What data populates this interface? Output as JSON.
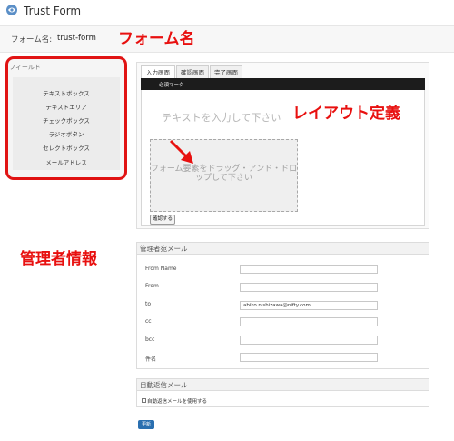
{
  "header": {
    "title": "Trust Form",
    "logo_icon": "trust-logo-icon"
  },
  "form_name": {
    "label": "フォーム名:",
    "value": "trust-form"
  },
  "annotations": {
    "form_name": "フォーム名",
    "layout": "レイアウト定義",
    "admin": "管理者情報",
    "color": "#e8100f"
  },
  "fields_panel": {
    "title": "フィールド",
    "items": [
      "テキストボックス",
      "テキストエリア",
      "チェックボックス",
      "ラジオボタン",
      "セレクトボックス",
      "メールアドレス"
    ]
  },
  "tabs": [
    {
      "label": "入力画面",
      "active": true
    },
    {
      "label": "確認画面",
      "active": false
    },
    {
      "label": "完了画面",
      "active": false
    }
  ],
  "input_screen": {
    "required_label": "必須マーク",
    "placeholder": "テキストを入力して下さい",
    "drop_hint": "フォーム要素をドラッグ・アンド・ドロップして下さい",
    "confirm_button": "確認する"
  },
  "admin_mail": {
    "title": "管理者宛メール",
    "rows": [
      {
        "label": "From Name",
        "value": ""
      },
      {
        "label": "From",
        "value": ""
      },
      {
        "label": "to",
        "value": "abiko.nishizawa@nifty.com"
      },
      {
        "label": "cc",
        "value": ""
      },
      {
        "label": "bcc",
        "value": ""
      },
      {
        "label": "件名",
        "value": ""
      }
    ]
  },
  "auto_reply": {
    "title": "自動返信メール",
    "checkbox_label": "自動返信メールを使用する",
    "checked": false
  },
  "update_button": "更新"
}
